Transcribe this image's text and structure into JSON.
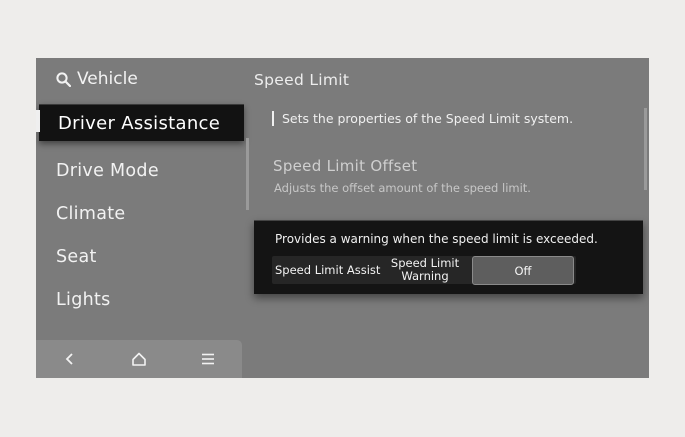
{
  "sidebar": {
    "search_label": "Vehicle",
    "items": [
      {
        "label": "Driver Assistance",
        "active": true
      },
      {
        "label": "Drive Mode"
      },
      {
        "label": "Climate"
      },
      {
        "label": "Seat"
      },
      {
        "label": "Lights"
      }
    ],
    "bottom_icons": [
      "back-icon",
      "home-icon",
      "menu-icon"
    ]
  },
  "content": {
    "title": "Speed Limit",
    "description": "Sets the properties of the Speed Limit system.",
    "offset": {
      "title": "Speed Limit Offset",
      "subtitle": "Adjusts the offset amount of the speed limit."
    },
    "warning": {
      "text": "Provides a warning when the speed limit is exceeded.",
      "options": [
        "Speed Limit Assist",
        "Speed Limit\nWarning",
        "Off"
      ],
      "selected": "Off"
    }
  },
  "colors": {
    "screen_bg": "#7b7b7b",
    "active_bg": "#121212",
    "panel_bg": "#141414",
    "page_bg": "#eeedeb"
  }
}
